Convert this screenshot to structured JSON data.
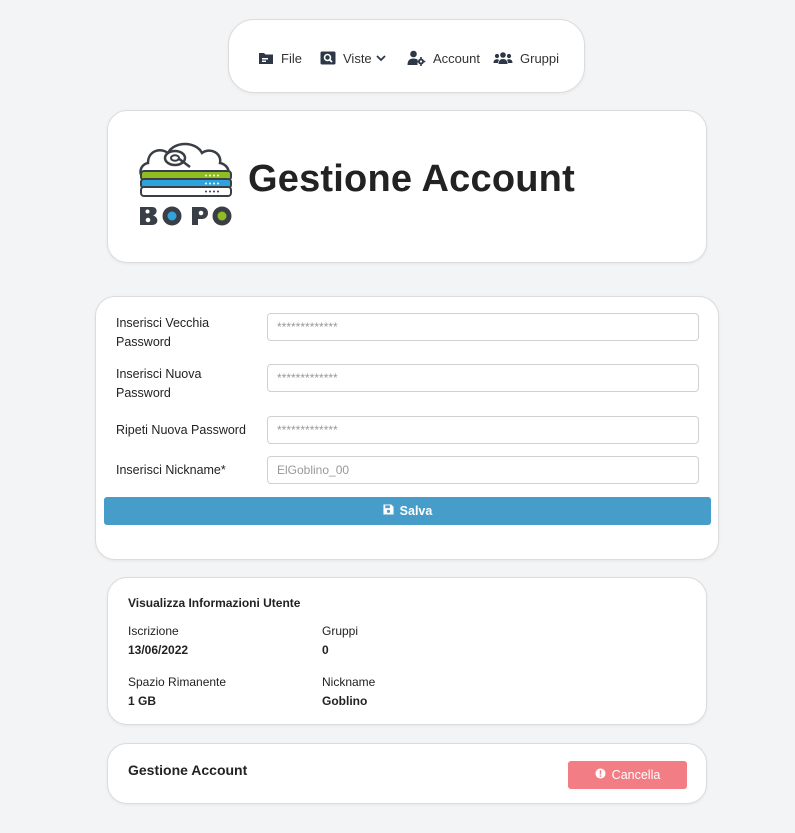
{
  "nav": {
    "file_label": "File",
    "viste_label": "Viste",
    "account_label": "Account",
    "gruppi_label": "Gruppi",
    "icons": [
      "folder-icon",
      "search-icon",
      "chevron-down-icon",
      "user-gear-icon",
      "users-icon"
    ]
  },
  "header": {
    "logo_text": "BOPO",
    "title": "Gestione Account"
  },
  "form": {
    "old_password_label": "Inserisci Vecchia Password",
    "old_password_placeholder": "*************",
    "new_password_label": "Inserisci Nuova Password",
    "new_password_placeholder": "*************",
    "repeat_password_label": "Ripeti Nuova Password",
    "repeat_password_placeholder": "*************",
    "nickname_label": "Inserisci Nickname*",
    "nickname_placeholder": "ElGoblino_00",
    "save_label": "Salva"
  },
  "info": {
    "heading": "Visualizza Informazioni Utente",
    "iscrizione_label": "Iscrizione",
    "iscrizione_value": "13/06/2022",
    "gruppi_label": "Gruppi",
    "gruppi_value": "0",
    "spazio_label": "Spazio Rimanente",
    "spazio_value": "1 GB",
    "nickname_label": "Nickname",
    "nickname_value": "Goblino"
  },
  "delete": {
    "title": "Gestione Account",
    "cancel_label": "Cancella"
  },
  "colors": {
    "save_button": "#479dc9",
    "cancel_button": "#f27d84",
    "logo_green": "#8fbc1f",
    "logo_blue": "#2fa3dc",
    "background": "#f3f4f6"
  }
}
